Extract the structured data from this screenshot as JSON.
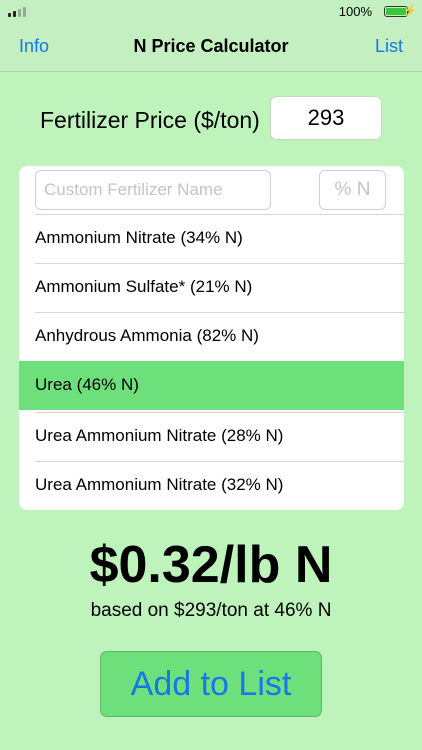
{
  "status_bar": {
    "battery_percent": "100%",
    "battery_level": 1.0,
    "battery_color": "#36c93a",
    "charging_icon": "bolt-icon",
    "signal_icon": "signal-icon"
  },
  "nav": {
    "left_label": "Info",
    "title": "N Price Calculator",
    "right_label": "List"
  },
  "price": {
    "label": "Fertilizer Price ($/ton)",
    "value": "293"
  },
  "custom": {
    "name_placeholder": "Custom Fertilizer Name",
    "pct_placeholder": "% N"
  },
  "fertilizers": [
    {
      "label": "Ammonium Nitrate (34% N)",
      "selected": false
    },
    {
      "label": "Ammonium Sulfate* (21% N)",
      "selected": false
    },
    {
      "label": "Anhydrous Ammonia (82% N)",
      "selected": false
    },
    {
      "label": "Urea (46% N)",
      "selected": true
    },
    {
      "label": "Urea Ammonium Nitrate (28% N)",
      "selected": false
    },
    {
      "label": "Urea Ammonium Nitrate (32% N)",
      "selected": false
    }
  ],
  "result": {
    "price_per_lb": "$0.32/lb N",
    "basis": "based on $293/ton at 46% N"
  },
  "actions": {
    "add_label": "Add to List"
  },
  "colors": {
    "background": "#bef4bc",
    "accent": "#1677e8",
    "selected": "#6ee07b"
  }
}
